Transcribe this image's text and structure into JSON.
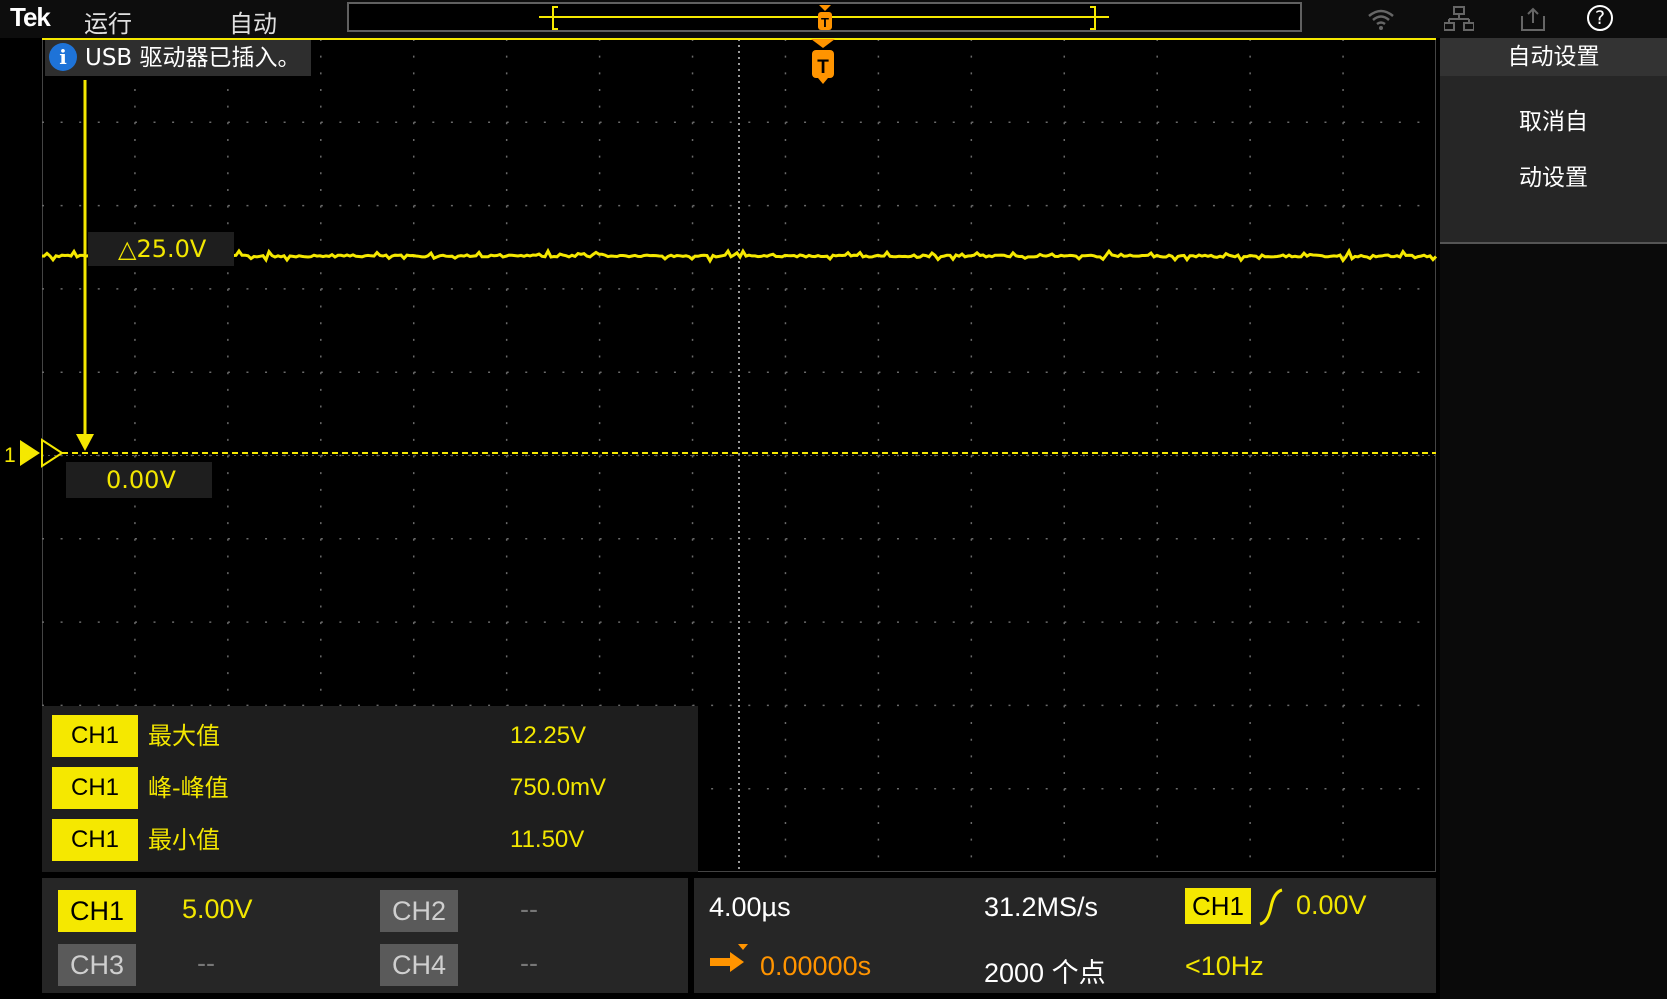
{
  "topbar": {
    "logo": "Tek",
    "run_label": "运行",
    "mode_label": "自动",
    "trigger_marker": "T",
    "help_glyph": "?"
  },
  "notification": {
    "icon": "info-icon",
    "icon_glyph": "i",
    "text": "USB 驱动器已插入。"
  },
  "waveform": {
    "delta_label": "△25.0V",
    "level_label": "0.00V",
    "channel_marker": "1",
    "trigger_marker": "T",
    "color": "#f5e800",
    "trigger_color": "#ff9400"
  },
  "measurements": [
    {
      "channel": "CH1",
      "name": "最大值",
      "value": "12.25V"
    },
    {
      "channel": "CH1",
      "name": "峰-峰值",
      "value": "750.0mV"
    },
    {
      "channel": "CH1",
      "name": "最小值",
      "value": "11.50V"
    }
  ],
  "right_panel": {
    "title": "自动设置",
    "button_line1": "取消自",
    "button_line2": "动设置"
  },
  "channels": {
    "ch1": {
      "label": "CH1",
      "scale": "5.00V"
    },
    "ch2": {
      "label": "CH2",
      "scale": "--"
    },
    "ch3": {
      "label": "CH3",
      "scale": "--"
    },
    "ch4": {
      "label": "CH4",
      "scale": "--"
    }
  },
  "horizontal": {
    "scale": "4.00µs",
    "sample_rate": "31.2MS/s",
    "position": "0.00000s",
    "record_length": "2000 个点"
  },
  "trigger": {
    "source": "CH1",
    "level": "0.00V",
    "frequency": "<10Hz",
    "slope_icon": "rising-edge-icon"
  }
}
